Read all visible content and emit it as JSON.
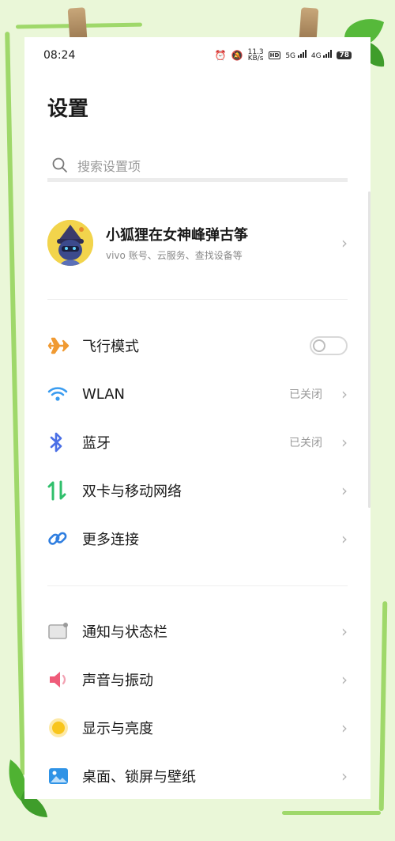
{
  "status": {
    "time": "08:24",
    "net_speed": "11.3",
    "net_unit": "KB/s",
    "hd": "HD",
    "signal1": "5G",
    "signal2": "4G",
    "battery": "78"
  },
  "page_title": "设置",
  "search": {
    "placeholder": "搜索设置项"
  },
  "account": {
    "name": "小狐狸在女神峰弹古筝",
    "subtitle": "vivo 账号、云服务、查找设备等"
  },
  "group1": [
    {
      "label": "飞行模式",
      "icon": "airplane-icon",
      "color": "#f09a32",
      "toggle": false
    },
    {
      "label": "WLAN",
      "value": "已关闭",
      "icon": "wifi-icon",
      "color": "#3a9cf0"
    },
    {
      "label": "蓝牙",
      "value": "已关闭",
      "icon": "bluetooth-icon",
      "color": "#4b6fe6"
    },
    {
      "label": "双卡与移动网络",
      "icon": "dual-sim-icon",
      "color": "#2fbf6b"
    },
    {
      "label": "更多连接",
      "icon": "link-icon",
      "color": "#2f7ee0"
    }
  ],
  "group2": [
    {
      "label": "通知与状态栏",
      "icon": "notification-icon",
      "color": "#9a9a9a"
    },
    {
      "label": "声音与振动",
      "icon": "sound-icon",
      "color": "#ef5b79"
    },
    {
      "label": "显示与亮度",
      "icon": "brightness-icon",
      "color": "#f8c51c"
    },
    {
      "label": "桌面、锁屏与壁纸",
      "icon": "wallpaper-icon",
      "color": "#2f93e6"
    }
  ]
}
